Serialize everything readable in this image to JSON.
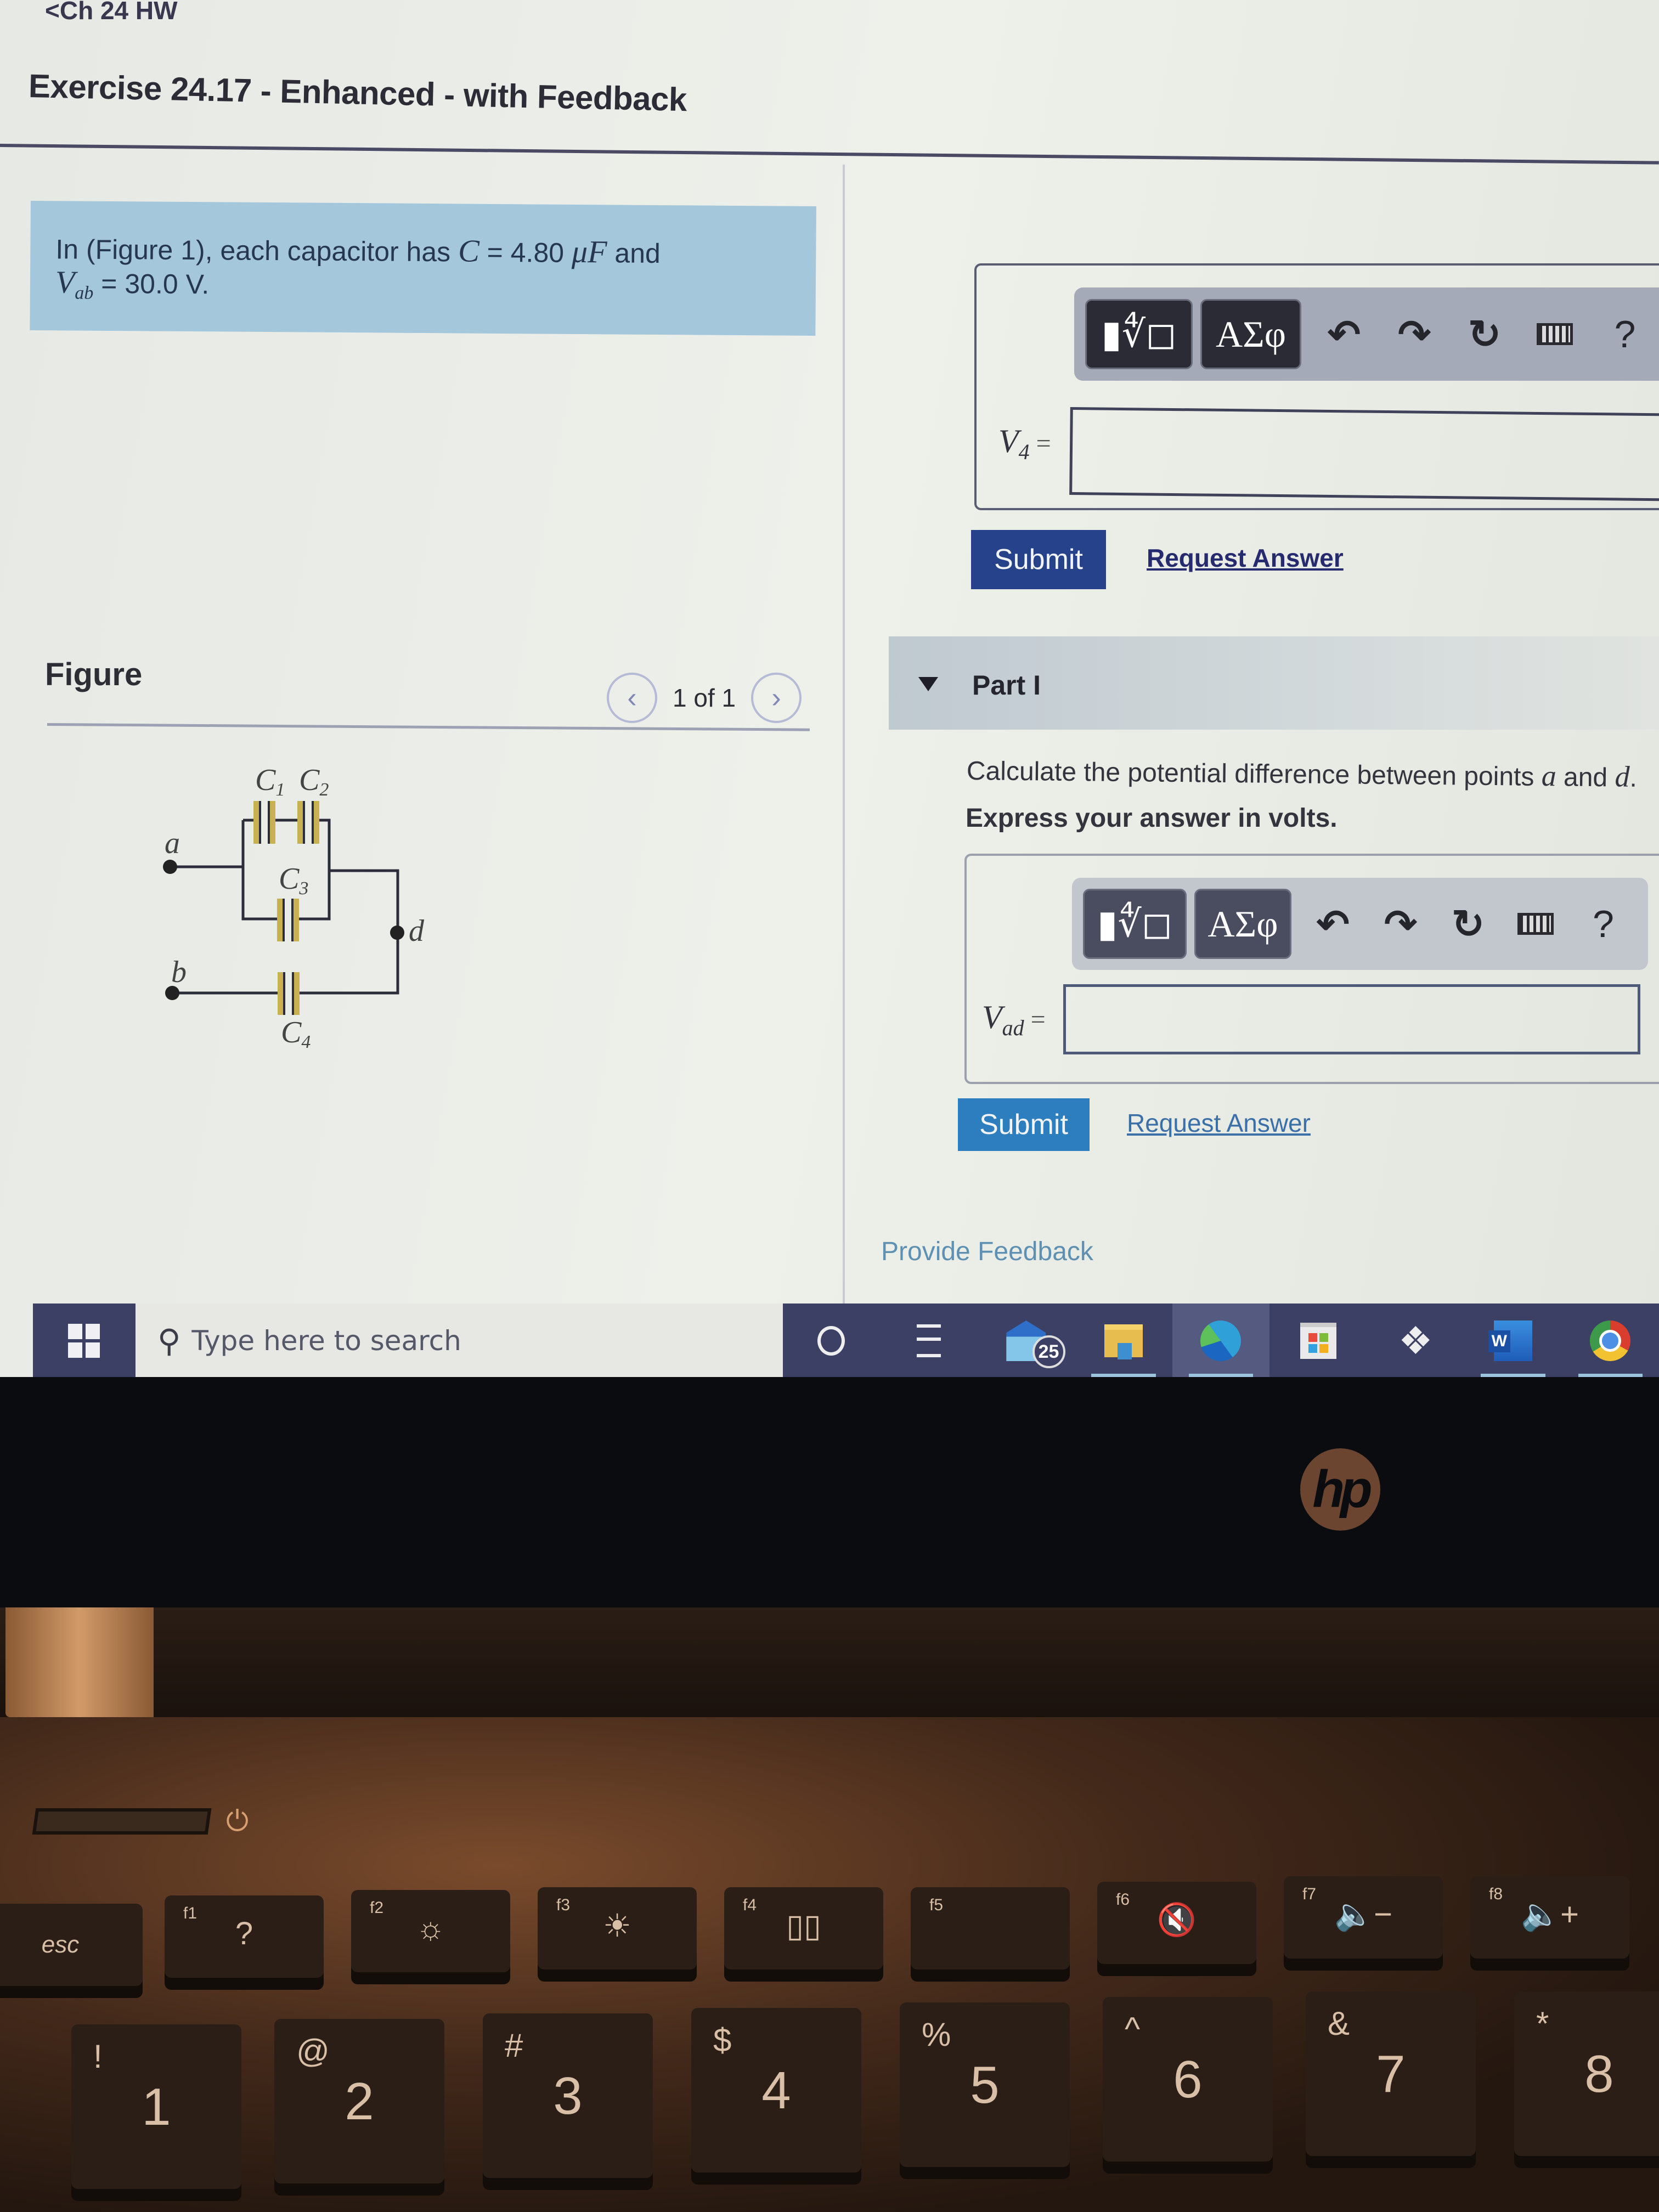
{
  "breadcrumb": {
    "back_label": "Ch 24 HW",
    "back_icon": "chevron-left-icon"
  },
  "page": {
    "title": "Exercise 24.17 - Enhanced - with Feedback"
  },
  "intro": {
    "prefix": "In (Figure 1), each capacitor has ",
    "c_symbol": "C",
    "c_value": " = 4.80 ",
    "c_unit": "μF",
    "suffix": " and",
    "v_symbol": "V",
    "v_sub": "ab",
    "v_value": " = 30.0 V."
  },
  "figure": {
    "heading": "Figure",
    "pager": {
      "prev_icon": "chevron-left-icon",
      "count": "1 of 1",
      "next_icon": "chevron-right-icon"
    },
    "labels": {
      "c1": "C",
      "c1_sub": "1",
      "c2": "C",
      "c2_sub": "2",
      "c3": "C",
      "c3_sub": "3",
      "c4": "C",
      "c4_sub": "4",
      "a": "a",
      "b": "b",
      "d": "d"
    },
    "colors": {
      "plate": "#c9b050",
      "wire": "#2b2d3a"
    }
  },
  "previous_part": {
    "toolbar": {
      "templates_label": "▮∜◻",
      "symbols_label": "ΑΣφ",
      "undo_icon": "↶",
      "redo_icon": "↷",
      "reset_icon": "↻",
      "help_label": "?"
    },
    "answer_label": "V",
    "answer_sub": "4",
    "answer_eq": "=",
    "answer_value": "",
    "submit_label": "Submit",
    "request_label": "Request Answer"
  },
  "part_i": {
    "caret_icon": "triangle-down-icon",
    "title": "Part I",
    "question_prefix": "Calculate the potential difference between points ",
    "point_a": "a",
    "question_mid": " and ",
    "point_d": "d",
    "question_suffix": ".",
    "instruction": "Express your answer in volts.",
    "toolbar": {
      "templates_label": "▮∜◻",
      "symbols_label": "ΑΣφ",
      "undo_icon": "↶",
      "redo_icon": "↷",
      "reset_icon": "↻",
      "help_label": "?"
    },
    "answer_label": "V",
    "answer_sub": "ad",
    "answer_eq": "=",
    "answer_value": "",
    "submit_label": "Submit",
    "request_label": "Request Answer"
  },
  "feedback": {
    "label": "Provide Feedback"
  },
  "taskbar": {
    "search_placeholder": "Type here to search",
    "apps": [
      {
        "name": "cortana",
        "active": false
      },
      {
        "name": "task-view",
        "active": false
      },
      {
        "name": "mail",
        "badge": "25",
        "active": false
      },
      {
        "name": "file-explorer",
        "active": false
      },
      {
        "name": "edge",
        "active": true
      },
      {
        "name": "microsoft-store",
        "active": false
      },
      {
        "name": "dropbox",
        "active": false
      },
      {
        "name": "word",
        "active": false
      },
      {
        "name": "chrome",
        "active": false
      }
    ]
  },
  "laptop": {
    "brand": "hp",
    "function_keys": [
      {
        "fn": "",
        "glyph": "esc"
      },
      {
        "fn": "f1",
        "glyph": "?"
      },
      {
        "fn": "f2",
        "glyph": "☼"
      },
      {
        "fn": "f3",
        "glyph": "☀"
      },
      {
        "fn": "f4",
        "glyph": "▯▯"
      },
      {
        "fn": "f5",
        "glyph": ""
      },
      {
        "fn": "f6",
        "glyph": "🔇"
      },
      {
        "fn": "f7",
        "glyph": "🔈−"
      },
      {
        "fn": "f8",
        "glyph": "🔈+"
      }
    ],
    "number_keys": [
      {
        "shift": "!",
        "main": "1"
      },
      {
        "shift": "@",
        "main": "2"
      },
      {
        "shift": "#",
        "main": "3"
      },
      {
        "shift": "$",
        "main": "4"
      },
      {
        "shift": "%",
        "main": "5"
      },
      {
        "shift": "^",
        "main": "6"
      },
      {
        "shift": "&",
        "main": "7"
      },
      {
        "shift": "*",
        "main": "8"
      }
    ]
  }
}
